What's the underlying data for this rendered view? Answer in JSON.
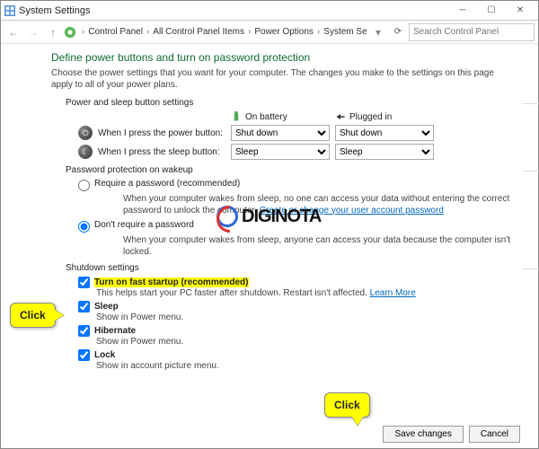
{
  "window": {
    "title": "System Settings"
  },
  "breadcrumb": [
    "Control Panel",
    "All Control Panel Items",
    "Power Options",
    "System Settings"
  ],
  "search": {
    "placeholder": "Search Control Panel"
  },
  "page": {
    "heading": "Define power buttons and turn on password protection",
    "description": "Choose the power settings that you want for your computer. The changes you make to the settings on this page apply to all of your power plans."
  },
  "sections": {
    "power_sleep": "Power and sleep button settings",
    "password": "Password protection on wakeup",
    "shutdown": "Shutdown settings"
  },
  "columns": {
    "battery": "On battery",
    "plugged": "Plugged in"
  },
  "power_rows": [
    {
      "label": "When I press the power button:",
      "battery": "Shut down",
      "plugged": "Shut down"
    },
    {
      "label": "When I press the sleep button:",
      "battery": "Sleep",
      "plugged": "Sleep"
    }
  ],
  "password": {
    "require": {
      "label": "Require a password (recommended)",
      "checked": false,
      "desc": "When your computer wakes from sleep, no one can access your data without entering the correct password to unlock the computer.",
      "link": "Create or change your user account password"
    },
    "dont": {
      "label": "Don't require a password",
      "checked": true,
      "desc": "When your computer wakes from sleep, anyone can access your data because the computer isn't locked."
    }
  },
  "shutdown": {
    "fast": {
      "label": "Turn on fast startup (recommended)",
      "checked": true,
      "desc": "This helps start your PC faster after shutdown. Restart isn't affected.",
      "link": "Learn More"
    },
    "sleep": {
      "label": "Sleep",
      "checked": true,
      "desc": "Show in Power menu."
    },
    "hiber": {
      "label": "Hibernate",
      "checked": true,
      "desc": "Show in Power menu."
    },
    "lock": {
      "label": "Lock",
      "checked": true,
      "desc": "Show in account picture menu."
    }
  },
  "buttons": {
    "save": "Save changes",
    "cancel": "Cancel"
  },
  "watermark": "DIGINOTA",
  "callout": "Click"
}
